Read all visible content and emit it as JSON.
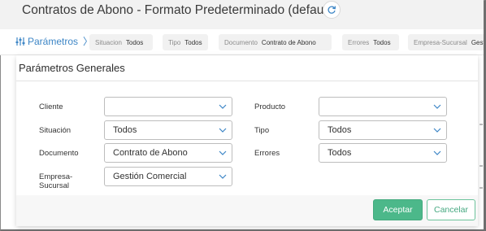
{
  "header": {
    "title": "Contratos de Abono - Formato Predeterminado (default)"
  },
  "params_bar": {
    "link_label": "Parámetros",
    "chips": [
      {
        "key": "Situacion",
        "value": "Todos"
      },
      {
        "key": "Tipo",
        "value": "Todos"
      },
      {
        "key": "Documento",
        "value": "Contrato de Abono"
      },
      {
        "key": "Errores",
        "value": "Todos"
      },
      {
        "key": "Empresa-Sucursal",
        "value": "Gestión Comercial"
      }
    ]
  },
  "dialog": {
    "title": "Parámetros Generales",
    "fields": {
      "cliente": {
        "label": "Cliente",
        "value": ""
      },
      "producto": {
        "label": "Producto",
        "value": ""
      },
      "situacion": {
        "label": "Situación",
        "value": "Todos"
      },
      "tipo": {
        "label": "Tipo",
        "value": "Todos"
      },
      "documento": {
        "label": "Documento",
        "value": "Contrato de Abono"
      },
      "errores": {
        "label": "Errores",
        "value": "Todos"
      },
      "empresa": {
        "label": "Empresa-Sucursal",
        "value": "Gestión Comercial"
      }
    },
    "accept_label": "Aceptar",
    "cancel_label": "Cancelar"
  },
  "colors": {
    "accent_blue": "#3d86c6",
    "accept_green": "#4cb88a"
  }
}
